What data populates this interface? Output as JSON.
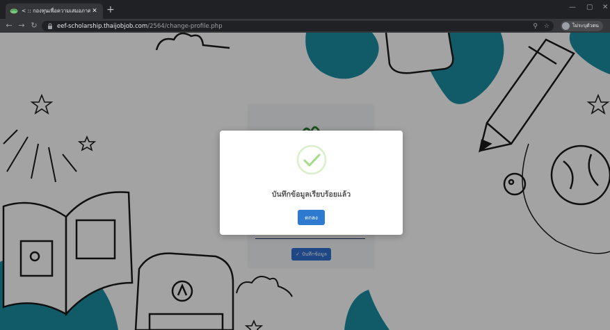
{
  "browser": {
    "tab_title": "< :: กองทุนเพื่อความเสมอภาคทางการศึ",
    "new_tab": "+",
    "url_host": "eef-scholarship.thaijobjob.com",
    "url_path": "/2564/change-profile.php",
    "profile_label": "ไม่ระบุตัวตน",
    "win_min": "—",
    "win_max": "▢",
    "win_close": "✕"
  },
  "form": {
    "save_label": "บันทึกข้อมูล"
  },
  "dialog": {
    "message": "บันทึกข้อมูลเรียบร้อยแล้ว",
    "ok_label": "ตกลง"
  },
  "colors": {
    "accent_teal": "#1c8fa3",
    "ok_button": "#2e7ad0",
    "success_green": "#a5dc86"
  }
}
